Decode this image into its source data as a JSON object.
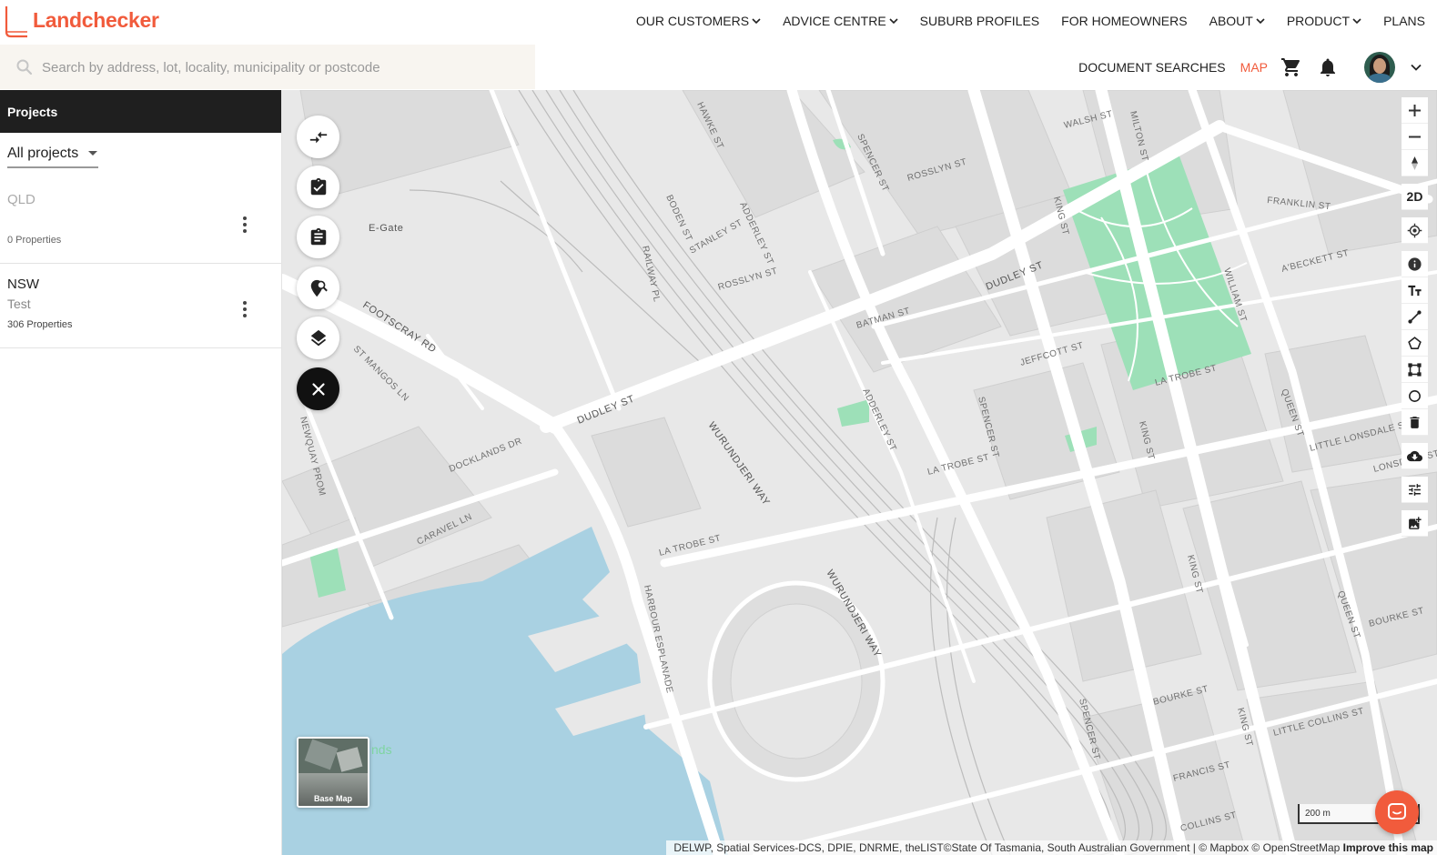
{
  "app": {
    "name": "Landchecker",
    "brand_color": "#f15b3c"
  },
  "nav": {
    "items": [
      {
        "label": "OUR CUSTOMERS",
        "dropdown": true
      },
      {
        "label": "ADVICE CENTRE",
        "dropdown": true
      },
      {
        "label": "SUBURB PROFILES",
        "dropdown": false
      },
      {
        "label": "FOR HOMEOWNERS",
        "dropdown": false
      },
      {
        "label": "ABOUT",
        "dropdown": true
      },
      {
        "label": "PRODUCT",
        "dropdown": true
      },
      {
        "label": "PLANS",
        "dropdown": false
      }
    ]
  },
  "search": {
    "placeholder": "Search by address, lot, locality, municipality or postcode",
    "value": ""
  },
  "header_right": {
    "document_searches": "DOCUMENT SEARCHES",
    "map": "MAP",
    "icons": [
      "cart-icon",
      "bell-icon",
      "avatar",
      "chevron-down-icon"
    ]
  },
  "panel": {
    "title": "Projects",
    "filter": "All projects",
    "projects": [
      {
        "name": "QLD",
        "description": "",
        "count": "0 Properties"
      },
      {
        "name": "NSW",
        "description": "Test",
        "count": "306 Properties"
      }
    ]
  },
  "map": {
    "place_labels": [
      "E-Gate",
      "FOOTSCRAY RD",
      "DUDLEY ST",
      "WURUNDJERI WAY",
      "SPENCER ST",
      "KING ST",
      "WILLIAM ST",
      "LA TROBE ST",
      "HARBOUR ESPLANADE",
      "DOCKLANDS DR",
      "BATMAN ST",
      "ADDERLEY ST",
      "ROSSLYN ST",
      "JEFFCOTT ST",
      "FRANKLIN ST",
      "A'BECKETT ST",
      "LITTLE LONSDALE ST",
      "LONSDALE ST",
      "BOURKE ST",
      "LITTLE COLLINS ST",
      "COLLINS ST",
      "CARAVEL LN",
      "STANLEY ST",
      "RAILWAY PL",
      "BODEN ST",
      "WALSH ST",
      "MILTON ST",
      "HAWKE ST",
      "ST MANGOS LN",
      "NEWQUAY PROM",
      "FRANCIS ST",
      "QUEEN ST"
    ],
    "left_tools": [
      "compare-icon",
      "checklist-icon",
      "clipboard-icon",
      "location-search-icon",
      "layers-icon",
      "close-icon"
    ],
    "right_tools": [
      "zoom-in-icon",
      "zoom-out-icon",
      "compass-icon",
      "2D",
      "locate-icon",
      "info-icon",
      "text-tool-icon",
      "line-tool-icon",
      "polygon-tool-icon",
      "square-tool-icon",
      "circle-tool-icon",
      "trash-icon",
      "download-icon",
      "filter-sliders-icon",
      "add-image-icon"
    ],
    "toggle_2d": "2D",
    "basemap_label": "Base Map",
    "basemap_overlap_text": "nds",
    "scale": "200 m",
    "attribution": "DELWP, Spatial Services-DCS, DPIE, DNRME, theLIST©State Of Tasmania, South Australian Government | © Mapbox © OpenStreetMap",
    "improve_link": "Improve this map",
    "colors": {
      "land": "#e8e8e8",
      "road": "#ffffff",
      "block": "#dcdcdc",
      "park": "#9de0b8",
      "water": "#a9d1e2"
    }
  }
}
